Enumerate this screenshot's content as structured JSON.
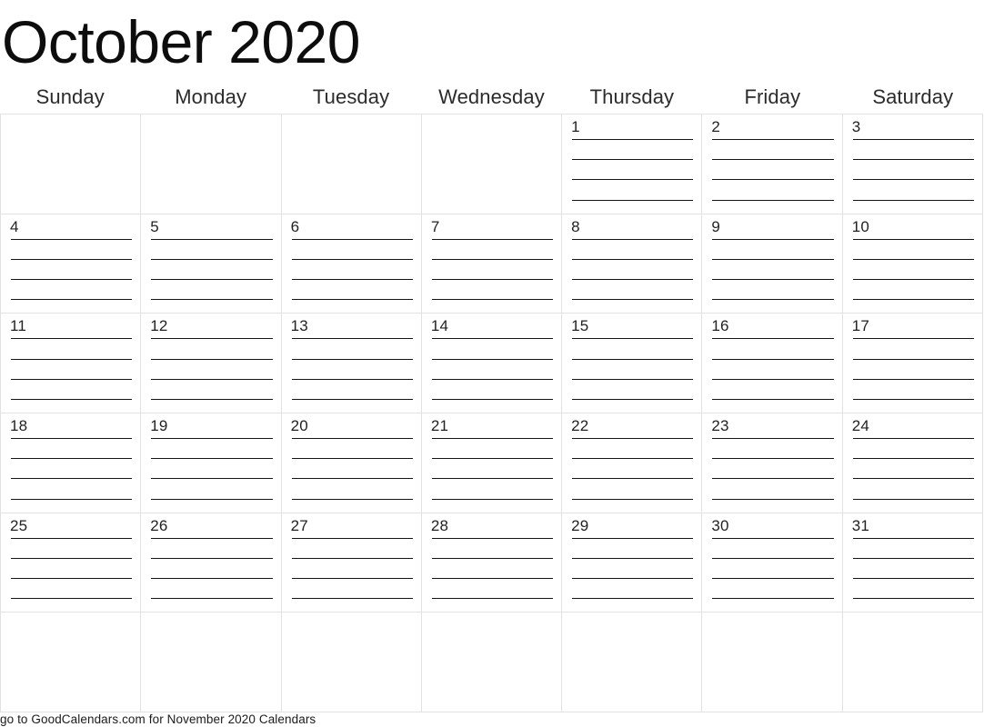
{
  "title": "October 2020",
  "month": "October",
  "year": "2020",
  "colors": {
    "page_background": "#ffffff",
    "grid_border": "#e2e2e2",
    "rule_line": "#151515",
    "title_text": "#0d0d0d",
    "weekday_text": "#2b2b2b",
    "day_number_text": "#222222",
    "footer_text": "#1b1b1b"
  },
  "weekdays": [
    "Sunday",
    "Monday",
    "Tuesday",
    "Wednesday",
    "Thursday",
    "Friday",
    "Saturday"
  ],
  "lines_per_day": 4,
  "weeks": [
    {
      "days": [
        "",
        "",
        "",
        "",
        "1",
        "2",
        "3"
      ]
    },
    {
      "days": [
        "4",
        "5",
        "6",
        "7",
        "8",
        "9",
        "10"
      ]
    },
    {
      "days": [
        "11",
        "12",
        "13",
        "14",
        "15",
        "16",
        "17"
      ]
    },
    {
      "days": [
        "18",
        "19",
        "20",
        "21",
        "22",
        "23",
        "24"
      ]
    },
    {
      "days": [
        "25",
        "26",
        "27",
        "28",
        "29",
        "30",
        "31"
      ]
    },
    {
      "days": [
        "",
        "",
        "",
        "",
        "",
        "",
        ""
      ]
    }
  ],
  "footer": {
    "text": "go to GoodCalendars.com for November 2020 Calendars"
  }
}
